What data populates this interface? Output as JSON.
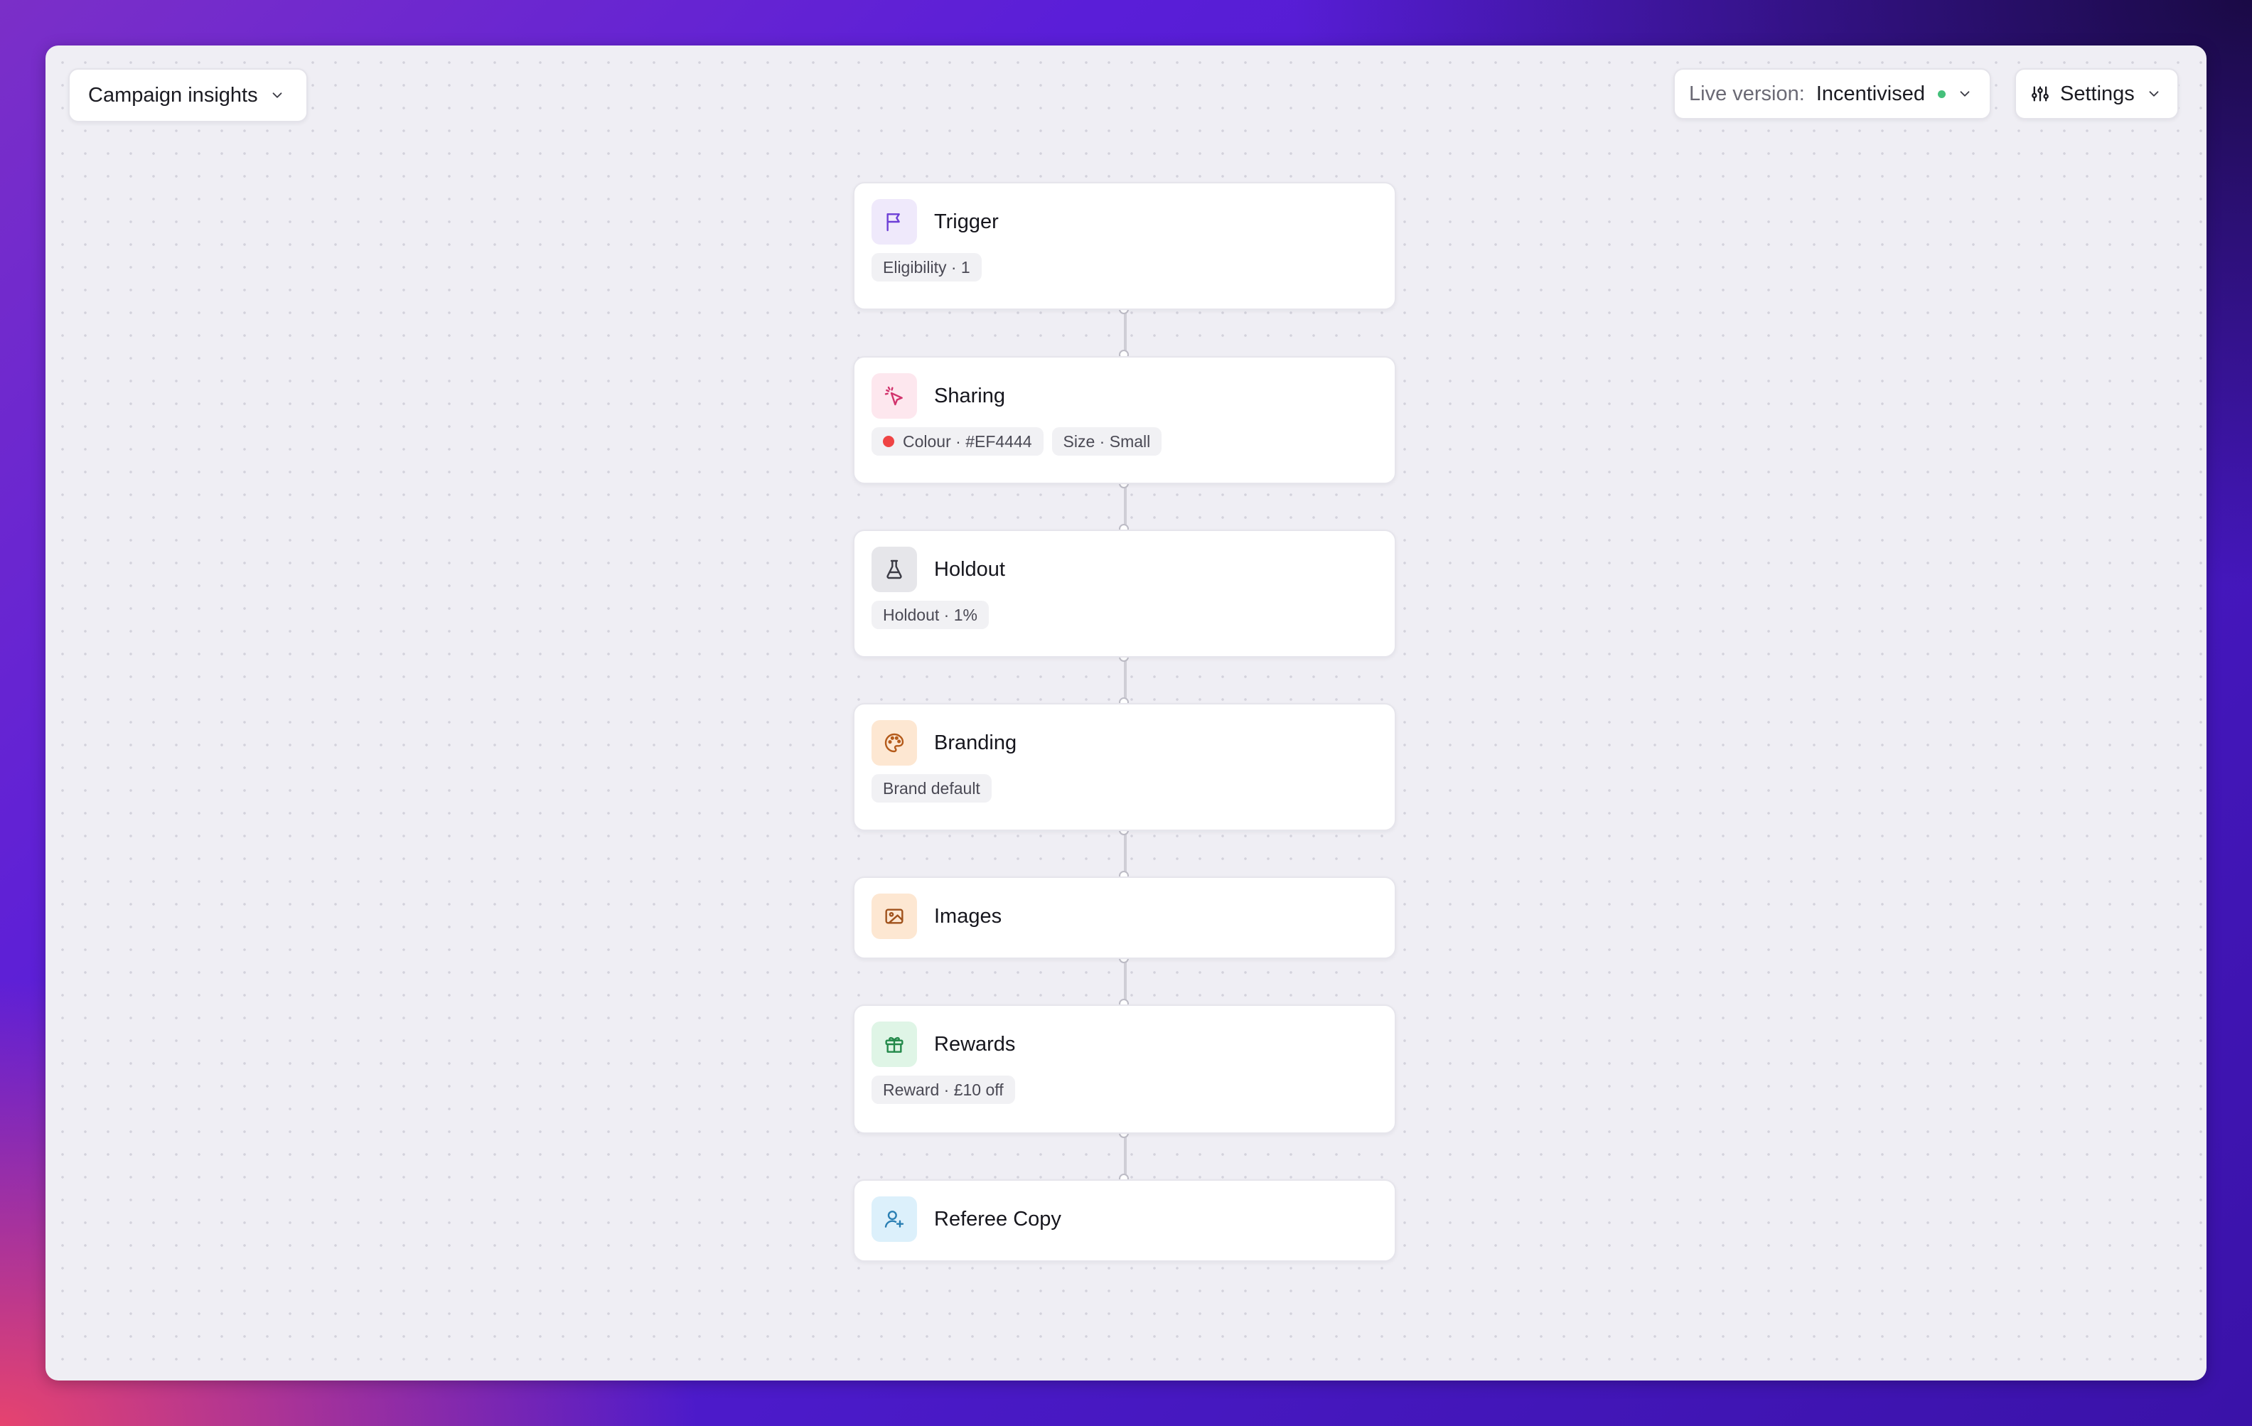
{
  "toolbar": {
    "campaign_label": "Campaign insights",
    "live_version_label": "Live version:",
    "live_version_value": "Incentivised",
    "live_status_color": "#45c07b",
    "settings_label": "Settings"
  },
  "flow": {
    "nodes": [
      {
        "id": "trigger",
        "title": "Trigger",
        "icon": "flag-icon",
        "icon_bg": "#efe9fb",
        "icon_color": "#6d3fd6",
        "tags": [
          "Eligibility · 1"
        ]
      },
      {
        "id": "sharing",
        "title": "Sharing",
        "icon": "cursor-click-icon",
        "icon_bg": "#fde7ee",
        "icon_color": "#d1336c",
        "tags": [
          "Colour · #EF4444",
          "Size · Small"
        ],
        "tag_dot_color": "#EF4444"
      },
      {
        "id": "holdout",
        "title": "Holdout",
        "icon": "flask-icon",
        "icon_bg": "#e6e6ea",
        "icon_color": "#3a3a44",
        "tags": [
          "Holdout · 1%"
        ]
      },
      {
        "id": "branding",
        "title": "Branding",
        "icon": "palette-icon",
        "icon_bg": "#fde7d2",
        "icon_color": "#b45a1a",
        "tags": [
          "Brand default"
        ]
      },
      {
        "id": "images",
        "title": "Images",
        "icon": "image-icon",
        "icon_bg": "#fde7d2",
        "icon_color": "#a0521c",
        "tags": []
      },
      {
        "id": "rewards",
        "title": "Rewards",
        "icon": "gift-icon",
        "icon_bg": "#dff5e6",
        "icon_color": "#23894a",
        "tags": [
          "Reward · £10 off"
        ]
      },
      {
        "id": "referee_copy",
        "title": "Referee Copy",
        "icon": "user-plus-icon",
        "icon_bg": "#dcf0fb",
        "icon_color": "#2a7fb3",
        "tags": []
      }
    ]
  }
}
